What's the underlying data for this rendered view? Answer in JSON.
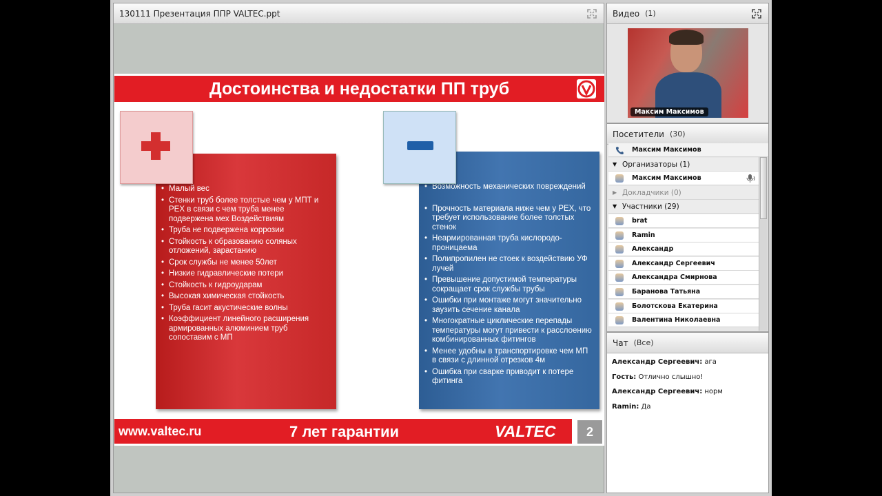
{
  "presentation": {
    "pod_title": "130111 Презентация ППР VALTEC.ppt",
    "slide": {
      "title": "Достоинства и недостатки ПП труб",
      "pros": [
        "Малый вес",
        "Стенки труб более толстые чем у МПТ и PEX в связи с чем труба менее подвержена мех Воздействиям",
        "Труба не подвержена коррозии",
        "Стойкость к образованию соляных отложений, зарастанию",
        "Срок службы не менее 50лет",
        "Низкие гидравлические потери",
        "Стойкость к гидроударам",
        "Высокая химическая стойкость",
        "Труба гасит акустические волны",
        "Коэффициент линейного расширения армированных алюминием труб сопоставим с МП"
      ],
      "cons": [
        "Возможность механических повреждений",
        "Прочность материала ниже чем у PEX, что требует использование более толстых стенок",
        "Неармированная труба кислородо-проницаема",
        "Полипропилен не стоек к воздействию УФ лучей",
        "Превышение допустимой температуры сокращает срок службы трубы",
        "Ошибки при монтаже могут значительно заузить сечение канала",
        "Многократные циклические перепады температуры могут привести к расслоению комбинированных фитингов",
        "Менее удобны в транспортировке чем МП в связи с длинной отрезков 4м",
        "Ошибка при сварке приводит к потере фитинга"
      ],
      "footer_url": "www.valtec.ru",
      "footer_guarantee": "7 лет гарантии",
      "footer_brand": "VALTEC",
      "page_number": "2"
    }
  },
  "video": {
    "title": "Видео",
    "count": "(1)",
    "speaker_name": "Максим Максимов"
  },
  "attendees": {
    "title": "Посетители",
    "count": "(30)",
    "current_user": "Максим Максимов",
    "groups": {
      "hosts": "Организаторы (1)",
      "presenters": "Докладчики (0)",
      "participants": "Участники (29)"
    },
    "host": "Максим Максимов",
    "participants": [
      "brat",
      "Ramin",
      "Александр",
      "Александр Сергеевич",
      "Александра Смирнова",
      "Баранова Татьяна",
      "Болотскова Екатерина",
      "Валентина Николаевна"
    ]
  },
  "chat": {
    "title": "Чат",
    "scope": "(Все)",
    "messages": [
      {
        "author": "Александр Сергеевич:",
        "text": "ага"
      },
      {
        "author": "Гость:",
        "text": "Отлично слышно!"
      },
      {
        "author": "Александр Сергеевич:",
        "text": "норм"
      },
      {
        "author": "Ramin:",
        "text": "Да"
      }
    ]
  },
  "colors": {
    "brand_red": "#e21d24",
    "pros_panel": "#c62828",
    "cons_panel": "#3a6ba6"
  }
}
